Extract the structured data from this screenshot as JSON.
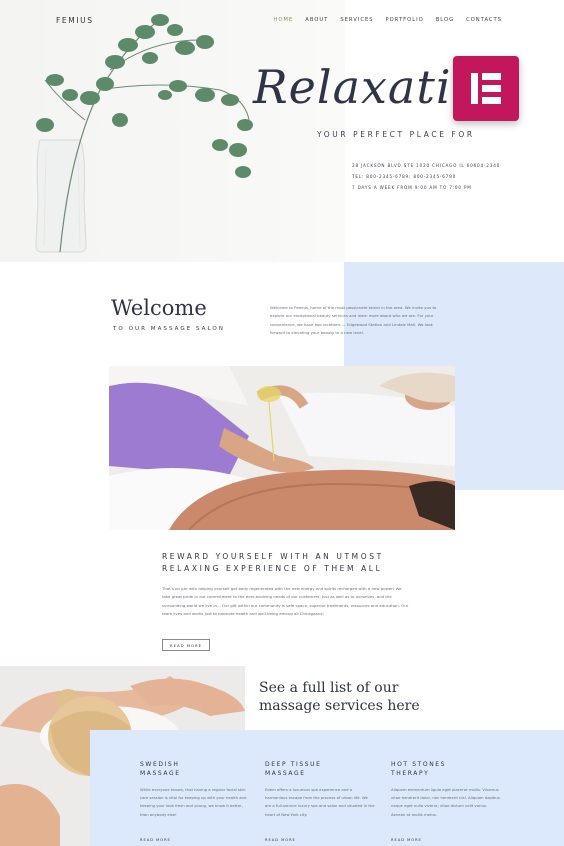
{
  "brand": {
    "logo": "FEMIUS"
  },
  "nav": {
    "items": [
      "HOME",
      "ABOUT",
      "SERVICES",
      "PORTFOLIO",
      "BLOG",
      "CONTACTS"
    ],
    "active": "HOME"
  },
  "hero": {
    "title": "Relaxatio",
    "subtitle": "YOUR PERFECT PLACE FOR",
    "address": "28 JACKSON BLVD STE 1020 CHICAGO IL 60604-2340",
    "phone": "TEL: 800-2345-6789; 800-2345-6790",
    "hours": "7 DAYS A WEEK FROM 9:00 AM TO 7:00 PM"
  },
  "badge": {
    "icon": "elementor-icon",
    "color": "#c2185b"
  },
  "welcome": {
    "title": "Welcome",
    "subtitle": "TO OUR MASSAGE SALON",
    "text": "Welcome to Femius, home of the most passionate talent in the area. We invite you to explore our exceptional beauty services and learn more about who we are. For your convenience, we have two locations — Edgewood Station and Lindale Mall. We look forward to elevating your beauty to a new level."
  },
  "reward": {
    "title_line1": "REWARD YOURSELF WITH AN UTMOST",
    "title_line2": "RELAXING EXPERIENCE OF THEM ALL",
    "text": "That's on par with helping yourself get body regenerated with the new energy and spirits recharged with a new power! We take great pride in our commitment to the ever-evolving needs of our customers. Just as well as to ourselves, and the surrounding world we live in... Our gift within our community is safe space, superior treatments, resources and education. Our team lives and works just to promote health and well-being among all Chicagoans!",
    "button": "READ MORE"
  },
  "services": {
    "heading_line1": "See a full list of our",
    "heading_line2": "massage services here",
    "items": [
      {
        "title_line1": "SWEDISH",
        "title_line2": "MASSAGE",
        "text": "While everyone knows, that having a regular facial skin care session is vital for keeping up with your health and keeping your look fresh and young, we know it better, than anybody else!",
        "more": "READ MORE"
      },
      {
        "title_line1": "DEEP TISSUE",
        "title_line2": "MASSAGE",
        "text": "Edem offers a luxurious spa experience and a harmonious escape from the process of urban life. We are a full-service luxury spa and salon and situated in the heart of New York city.",
        "more": "READ MORE"
      },
      {
        "title_line1": "HOT STONES",
        "title_line2": "THERAPY",
        "text": "Aliquam elementum ligula eget placerat mollis. Vivamus vitae hendrerit dolor, nec hendrerit nisl. Aliquam dapibus neque eget nulla viverra, vitae dictum velit varius. Aenean at mollis metus.",
        "more": "READ MORE"
      }
    ]
  }
}
